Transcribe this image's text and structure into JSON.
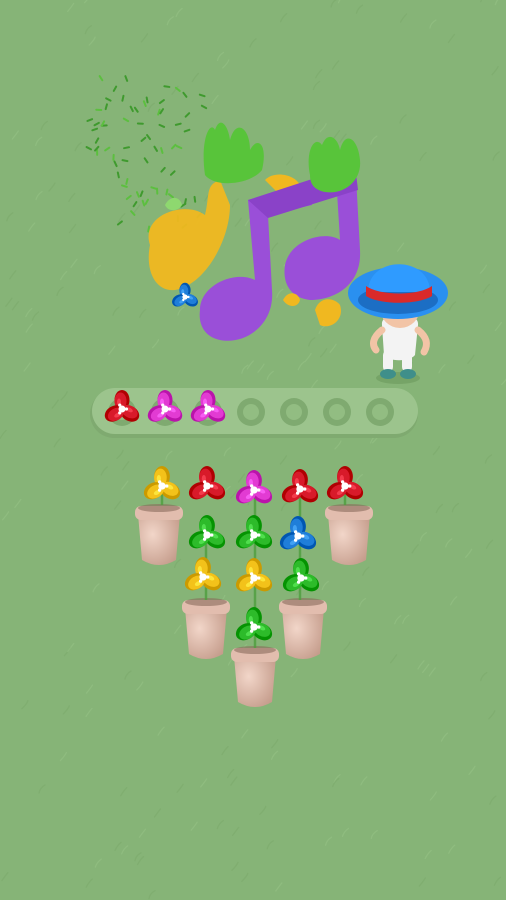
{
  "colors": {
    "background": "#86b477",
    "tray": "#9cc48d",
    "slot_empty": "#7faa70",
    "pot": "#d9b2a0",
    "pot_shadow": "#b98f7f",
    "petal_red": "#d81a2a",
    "petal_pink": "#e23bd3",
    "petal_yellow": "#f3c21a",
    "petal_green": "#2dbb2a",
    "petal_blue": "#1f7ed9",
    "note_purple": "#9a4fd8",
    "note_yellow": "#f0b820",
    "grass_top": "#58c43a",
    "hat": "#2a90f0",
    "hat_band": "#d92a2a"
  },
  "music_note": {
    "icon": "music-note-icon"
  },
  "character": {
    "icon": "gardener-character-icon",
    "hat_color": "blue",
    "band_color": "red"
  },
  "tray": {
    "total_slots": 7,
    "filled": [
      {
        "color": "red"
      },
      {
        "color": "pink"
      },
      {
        "color": "pink"
      }
    ]
  },
  "pots": [
    {
      "id": "pot-1",
      "flowers": [
        "yellow"
      ]
    },
    {
      "id": "pot-2",
      "flowers": [
        "green",
        "yellow"
      ]
    },
    {
      "id": "pot-3",
      "flowers": [
        "red",
        "green",
        "yellow",
        "green"
      ]
    },
    {
      "id": "pot-4",
      "flowers": [
        "pink",
        "green",
        "yellow"
      ]
    },
    {
      "id": "pot-5",
      "flowers": [
        "red",
        "blue",
        "green"
      ]
    },
    {
      "id": "pot-6",
      "flowers": [
        "red"
      ]
    }
  ]
}
